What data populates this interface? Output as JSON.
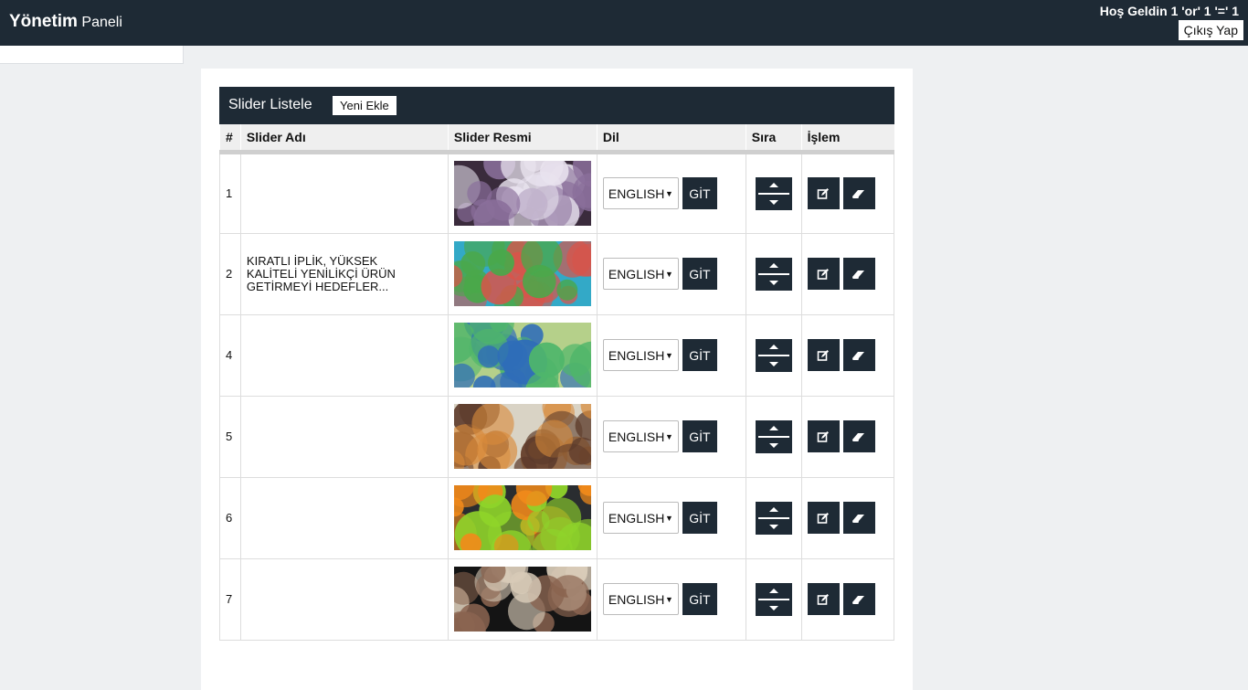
{
  "header": {
    "brand_bold": "Yönetim",
    "brand_light": "Paneli",
    "welcome": "Hoş Geldin 1 'or' 1 '=' 1",
    "logout_label": "Çıkış Yap"
  },
  "panel": {
    "title": "Slider Listele",
    "new_label": "Yeni Ekle"
  },
  "table": {
    "columns": [
      "#",
      "Slider Adı",
      "Slider Resmi",
      "Dil",
      "Sıra",
      "İşlem"
    ],
    "rows": [
      {
        "num": "1",
        "name": "",
        "language": "ENGLISH",
        "go": "GİT",
        "image_tint": [
          "#e9e3ef",
          "#8a6f9b",
          "#3a2b3c"
        ]
      },
      {
        "num": "2",
        "name": "KIRATLI İPLİK, YÜKSEK KALİTELİ YENİLİKÇİ ÜRÜN GETİRMEYİ HEDEFLER...",
        "language": "ENGLISH",
        "go": "GİT",
        "image_tint": [
          "#d9544a",
          "#4aa84a",
          "#33a9c7"
        ]
      },
      {
        "num": "4",
        "name": "",
        "language": "ENGLISH",
        "go": "GİT",
        "image_tint": [
          "#2f6db8",
          "#4fb66a",
          "#b5d08a"
        ]
      },
      {
        "num": "5",
        "name": "",
        "language": "ENGLISH",
        "go": "GİT",
        "image_tint": [
          "#5c3a2a",
          "#d98b3b",
          "#d9d3c5"
        ]
      },
      {
        "num": "6",
        "name": "",
        "language": "ENGLISH",
        "go": "GİT",
        "image_tint": [
          "#f28a1a",
          "#8fd42a",
          "#2a2d30"
        ]
      },
      {
        "num": "7",
        "name": "",
        "language": "ENGLISH",
        "go": "GİT",
        "image_tint": [
          "#d8cbb8",
          "#8a6450",
          "#141414"
        ]
      }
    ]
  },
  "icons": {
    "move": "up-down-arrows-icon",
    "edit": "edit-icon",
    "delete": "eraser-icon"
  },
  "colors": {
    "primary_dark": "#1e2a35",
    "page_bg": "#eef0f2"
  }
}
